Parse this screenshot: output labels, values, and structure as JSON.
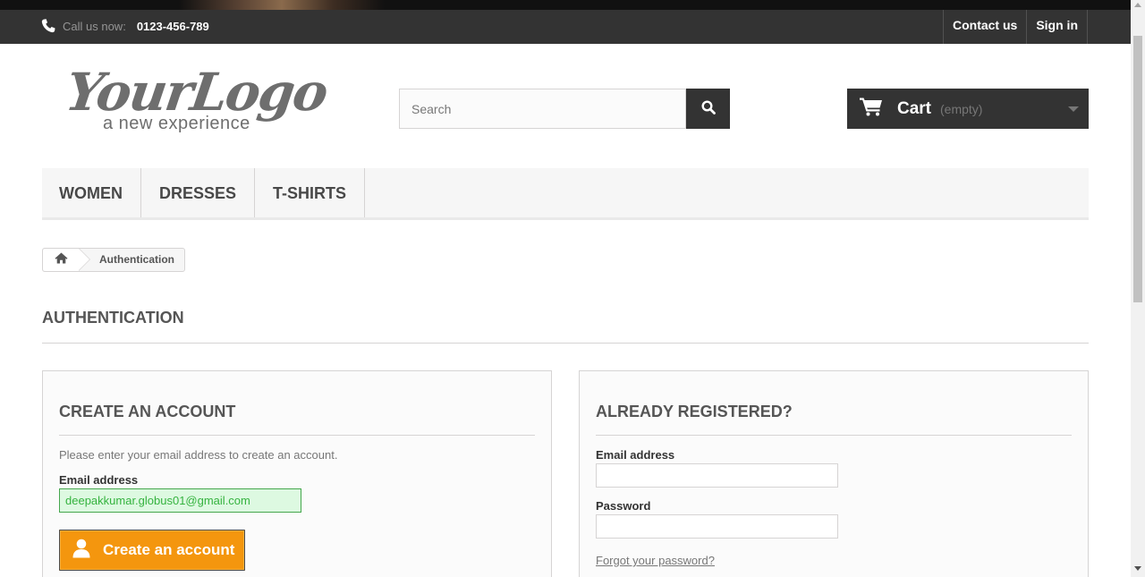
{
  "topbar": {
    "call_label": "Call us now:",
    "phone_number": "0123-456-789",
    "contact_label": "Contact us",
    "signin_label": "Sign in"
  },
  "header": {
    "logo_script": "YourLogo",
    "logo_tagline": "a new experience",
    "search_placeholder": "Search",
    "cart_label": "Cart",
    "cart_status": "(empty)"
  },
  "menu": {
    "items": [
      {
        "label": "Women"
      },
      {
        "label": "Dresses"
      },
      {
        "label": "T-shirts"
      }
    ]
  },
  "breadcrumb": {
    "current": "Authentication"
  },
  "page": {
    "heading": "Authentication"
  },
  "create_account": {
    "title": "Create an account",
    "intro": "Please enter your email address to create an account.",
    "email_label": "Email address",
    "email_value": "deepakkumar.globus01@gmail.com",
    "button_label": "Create an account"
  },
  "login": {
    "title": "Already registered?",
    "email_label": "Email address",
    "email_value": "",
    "password_label": "Password",
    "password_value": "",
    "forgot_label": "Forgot your password?"
  },
  "colors": {
    "topbar": "#333333",
    "accent_button": "#f4960e",
    "valid_field_bg": "#ddf9e1",
    "valid_field_text": "#35b33f"
  },
  "icons": {
    "phone": "phone-icon",
    "search": "search-icon",
    "cart": "cart-icon",
    "home": "home-icon",
    "user": "user-icon",
    "dropdown": "caret-down-icon"
  }
}
